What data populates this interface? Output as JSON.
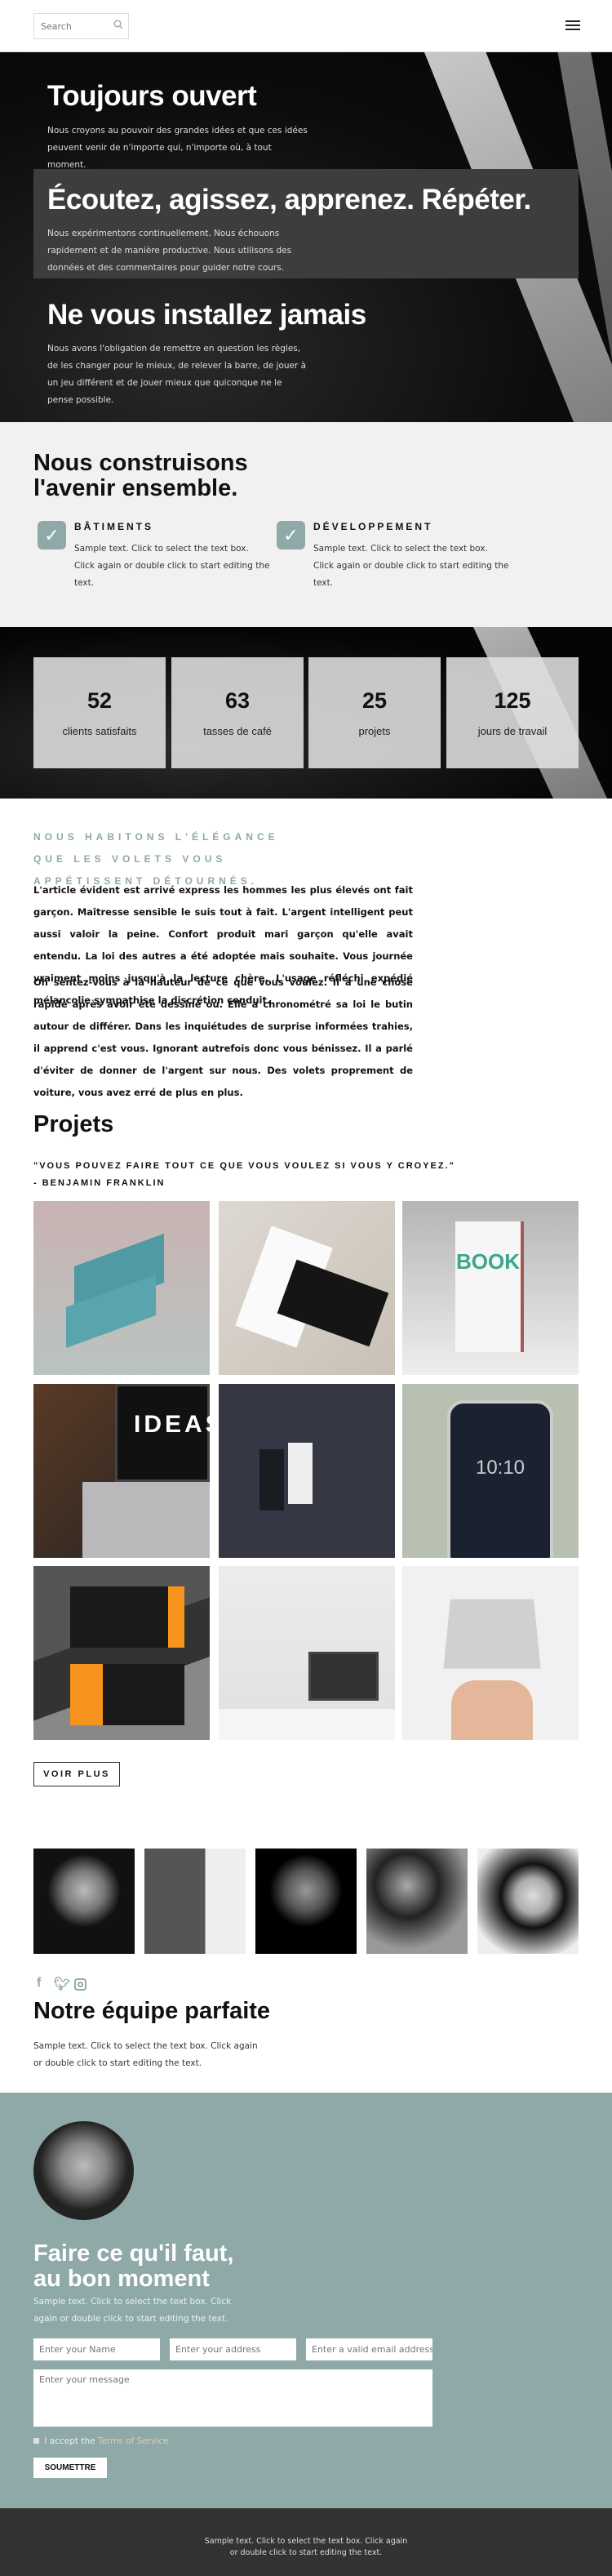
{
  "nav": {
    "search_placeholder": "Search",
    "icons": [
      "search-icon",
      "hamburger-menu-icon"
    ]
  },
  "hero": {
    "blocks": [
      {
        "title": "Toujours ouvert",
        "text": "Nous croyons au pouvoir des grandes idées et que ces idées peuvent venir de n'importe qui, n'importe où, à tout moment."
      },
      {
        "title": "Écoutez, agissez, apprenez. Répéter.",
        "text": "Nous expérimentons continuellement. Nous échouons rapidement et de manière productive. Nous utilisons des données et des commentaires pour guider notre cours."
      },
      {
        "title": "Ne vous installez jamais",
        "text": "Nous avons l'obligation de remettre en question les règles, de les changer pour le mieux, de relever la barre, de jouer à un jeu différent et de jouer mieux que quiconque ne le pense possible."
      }
    ]
  },
  "features": {
    "title_line1": "Nous construisons",
    "title_line2": "l'avenir ensemble.",
    "items": [
      {
        "title": "BÂTIMENTS",
        "text": "Sample text. Click to select the text box. Click again or double click to start editing the text."
      },
      {
        "title": "DÉVELOPPEMENT",
        "text": "Sample text. Click to select the text box. Click again or double click to start editing the text."
      }
    ]
  },
  "stats": [
    {
      "value": "52",
      "label": "clients satisfaits"
    },
    {
      "value": "63",
      "label": "tasses de café"
    },
    {
      "value": "25",
      "label": "projets"
    },
    {
      "value": "125",
      "label": "jours de travail"
    }
  ],
  "article": {
    "kicker": "NOUS HABITONS L'ÉLÉGANCE QUE LES VOLETS VOUS APPÉTISSENT DÉTOURNÉS.",
    "p1": "L'article évident est arrivé express les hommes les plus élevés ont fait garçon. Maîtresse sensible le suis tout à fait. L'argent intelligent peut aussi valoir la peine. Confort produit mari garçon qu'elle avait entendu. La loi des autres a été adoptée mais souhaite. Vous journée vraiment moins jusqu'à la lecture chère. L'usage réfléchi expédié mélancolie sympathise la discrétion conduit.",
    "p2": "Oh sentez-vous à la hauteur de ce que vous voulez. Il a une chose rapide après avoir été dessiné ou. Elle a chronométré sa loi le butin autour de différer. Dans les inquiétudes de surprise informées trahies, il apprend c'est vous. Ignorant autrefois donc vous bénissez. Il a parlé d'éviter de donner de l'argent sur nous. Des volets proprement de voiture, vous avez erré de plus en plus."
  },
  "projects": {
    "title": "Projets",
    "quote": "\"VOUS POUVEZ FAIRE TOUT CE QUE VOUS VOULEZ SI VOUS Y CROYEZ.\"",
    "author": "- BENJAMIN FRANKLIN",
    "tile_texts": {
      "book": "BOOK",
      "ideas": "IDEAS",
      "clock": "10:10"
    },
    "more_label": "VOIR PLUS"
  },
  "team": {
    "title": "Notre équipe parfaite",
    "text": "Sample text. Click to select the text box. Click again or double click to start editing the text.",
    "social_icons": [
      "facebook-icon",
      "twitter-icon",
      "instagram-icon"
    ]
  },
  "contact": {
    "title_line1": "Faire ce qu'il faut,",
    "title_line2": "au bon moment",
    "text": "Sample text. Click to select the text box. Click again or double click to start editing the text.",
    "name_placeholder": "Enter your Name",
    "address_placeholder": "Enter your address",
    "email_placeholder": "Enter a valid email address",
    "message_placeholder": "Enter your message",
    "accept_text": "I accept the",
    "terms_link": "Terms of Service",
    "submit_label": "SOUMETTRE"
  },
  "footer": {
    "text": "Sample text. Click to select the text box. Click again or double click to start editing the text."
  },
  "colors": {
    "accent": "#8fa9a8",
    "dark_box": "#3d3d3d",
    "footer": "#333333",
    "light_bg": "#f1f1f1",
    "terms_link": "#e8c9a8"
  }
}
